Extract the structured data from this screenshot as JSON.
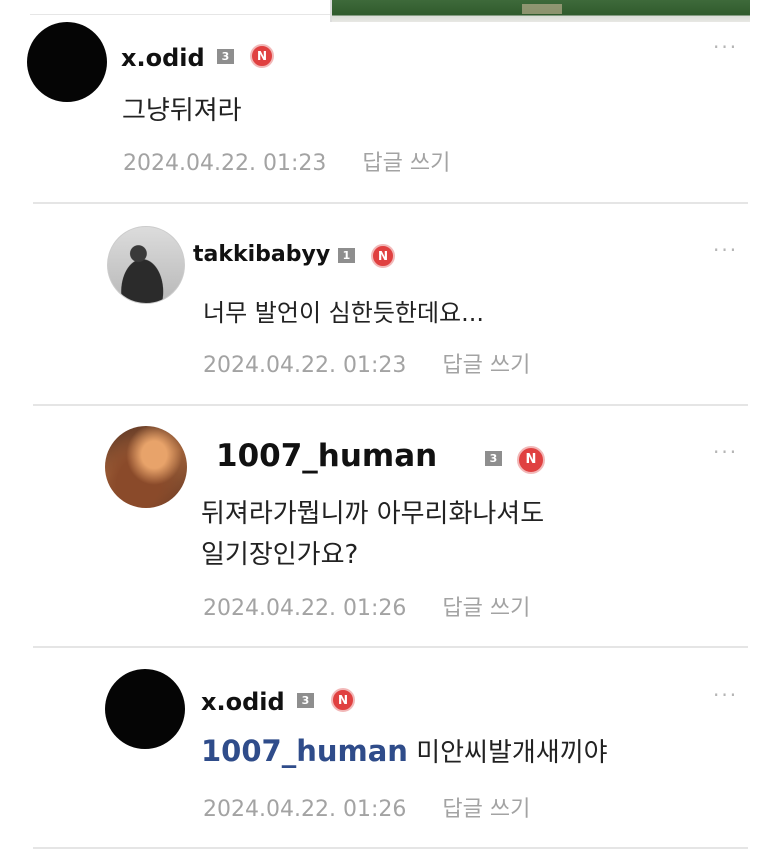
{
  "comments": [
    {
      "username": "x.odid",
      "level": "3",
      "new_badge": "N",
      "more": "···",
      "text": "그냥뒤져라",
      "date": "2024.04.22. 01:23",
      "reply_label": "답글 쓰기"
    },
    {
      "username": "takkibabyy",
      "level": "1",
      "new_badge": "N",
      "more": "···",
      "text": "너무 발언이 심한듯한데요...",
      "date": "2024.04.22. 01:23",
      "reply_label": "답글 쓰기"
    },
    {
      "username": "1007_human",
      "level": "3",
      "new_badge": "N",
      "more": "···",
      "text_line1": "뒤져라가뭡니까 아무리화나셔도",
      "text_line2": "일기장인가요?",
      "date": "2024.04.22. 01:26",
      "reply_label": "답글 쓰기"
    },
    {
      "username": "x.odid",
      "level": "3",
      "new_badge": "N",
      "more": "···",
      "mention": "1007_human",
      "text": "미안씨발개새끼야",
      "date": "2024.04.22. 01:26",
      "reply_label": "답글 쓰기"
    }
  ]
}
